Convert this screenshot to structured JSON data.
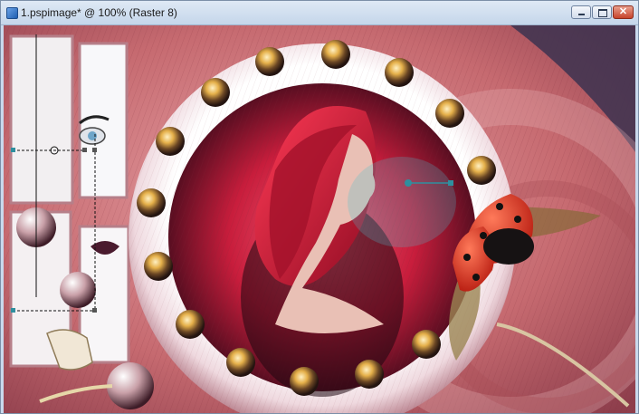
{
  "window": {
    "title": "1.pspimage* @ 100% (Raster 8)",
    "close_glyph": "✕"
  },
  "icons": {
    "app": "document-icon",
    "minimize": "minimize-icon",
    "maximize": "maximize-icon",
    "close": "close-icon"
  },
  "colors": {
    "background": "#c47378",
    "ring": "#f2e6ea",
    "accent_red": "#d4143a",
    "dark_shadow": "#2a1420",
    "handle": "#2f8f9f"
  }
}
